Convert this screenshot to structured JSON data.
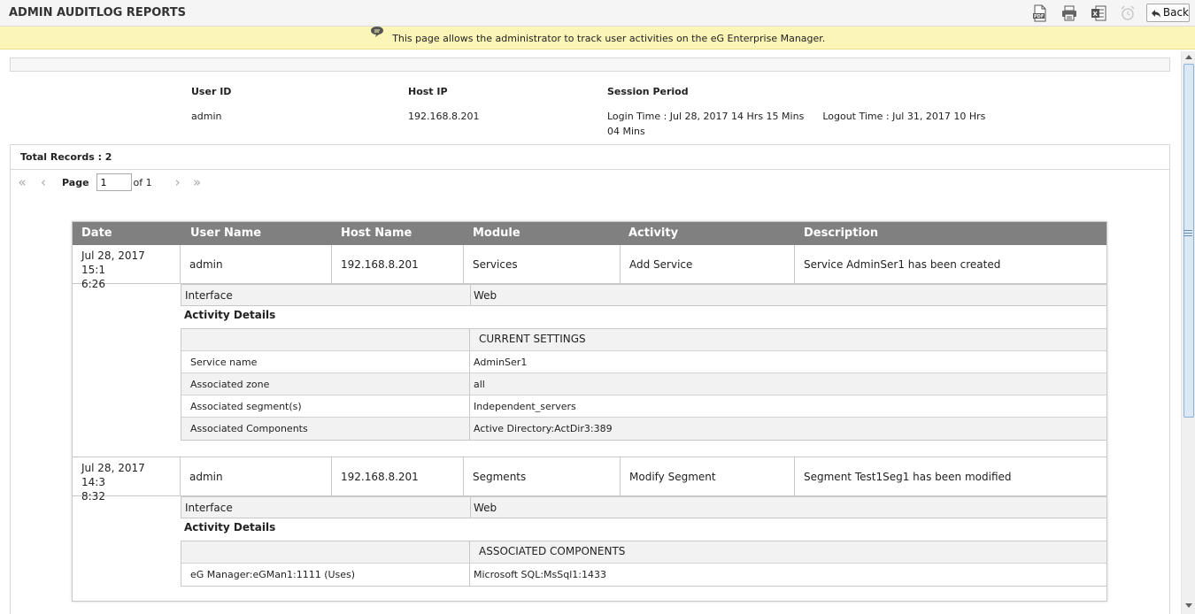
{
  "header": {
    "title": "ADMIN AUDITLOG REPORTS",
    "back_label": "Back"
  },
  "banner": {
    "text": "This page allows the administrator to track user activities on the eG Enterprise Manager."
  },
  "session": {
    "user_id_label": "User ID",
    "user_id": "admin",
    "host_ip_label": "Host IP",
    "host_ip": "192.168.8.201",
    "period_label": "Session Period",
    "login": "Login Time : Jul 28, 2017 14 Hrs 15 Mins",
    "login_cont": "04 Mins",
    "logout": "Logout Time : Jul 31, 2017 10 Hrs"
  },
  "records": {
    "total": "Total Records : 2"
  },
  "pager": {
    "page_label": "Page",
    "page_value": "1",
    "of_label": "of 1"
  },
  "table": {
    "columns": [
      "Date",
      "User Name",
      "Host Name",
      "Module",
      "Activity",
      "Description"
    ],
    "rows": [
      {
        "date_line1": "Jul 28, 2017 15:1",
        "date_line2": "6:26",
        "user": "admin",
        "host": "192.168.8.201",
        "module": "Services",
        "activity": "Add Service",
        "description": "Service AdminSer1 has been created",
        "interface_label": "Interface",
        "interface_value": "Web",
        "details_label": "Activity Details",
        "details_header": "CURRENT SETTINGS",
        "details": [
          {
            "k": "Service name",
            "v": "AdminSer1"
          },
          {
            "k": "Associated zone",
            "v": "all"
          },
          {
            "k": "Associated segment(s)",
            "v": "Independent_servers"
          },
          {
            "k": "Associated Components",
            "v": "Active Directory:ActDir3:389"
          }
        ]
      },
      {
        "date_line1": "Jul 28, 2017 14:3",
        "date_line2": "8:32",
        "user": "admin",
        "host": "192.168.8.201",
        "module": "Segments",
        "activity": "Modify Segment",
        "description": "Segment Test1Seg1 has been modified",
        "interface_label": "Interface",
        "interface_value": "Web",
        "details_label": "Activity Details",
        "details_header": "ASSOCIATED COMPONENTS",
        "details": [
          {
            "k": "eG Manager:eGMan1:1111 (Uses)",
            "v": "Microsoft SQL:MsSql1:1433"
          }
        ]
      }
    ]
  },
  "icons": {
    "pdf": "pdf-icon",
    "print": "print-icon",
    "excel": "excel-icon",
    "schedule": "alarm-clock-icon",
    "back": "back-arrow-icon",
    "info": "speech-bubble-icon"
  },
  "colors": {
    "banner_bg": "#fbf6b7",
    "table_header_bg": "#808080",
    "alt_row_bg": "#f2f2f2"
  }
}
